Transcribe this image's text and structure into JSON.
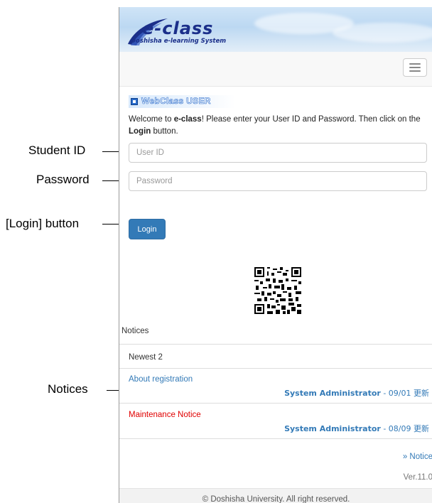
{
  "callouts": {
    "student_id": "Student ID",
    "password": "Password",
    "login_button": "[Login] button",
    "notices": "Notices"
  },
  "header": {
    "logo_title": "e-class",
    "logo_subtitle": "Doshisha e-learning System"
  },
  "navbar": {
    "menu_icon": "hamburger-icon"
  },
  "login": {
    "badge": "WebClass USER",
    "welcome_prefix": "Welcome to ",
    "welcome_brand": "e-class",
    "welcome_middle": "! Please enter your User ID and Password. Then click on the ",
    "welcome_button_word": "Login",
    "welcome_suffix": " button.",
    "user_id_placeholder": "User ID",
    "password_placeholder": "Password",
    "login_label": "Login"
  },
  "notices": {
    "title": "Notices",
    "newest_label": "Newest 2",
    "items": [
      {
        "title": "About registration",
        "author": "System Administrator",
        "date": " - 09/01 更新",
        "color": "#337ab7"
      },
      {
        "title": "Maintenance Notice",
        "author": "System Administrator",
        "date": " - 08/09 更新",
        "color": "#e00000"
      }
    ],
    "more_link": "» Notice",
    "version": "Ver.11.0"
  },
  "footer": {
    "copyright": "© Doshisha University. All right reserved."
  },
  "colors": {
    "primary": "#337ab7",
    "alert": "#e00000",
    "logo_blue": "#1b2f8a"
  }
}
